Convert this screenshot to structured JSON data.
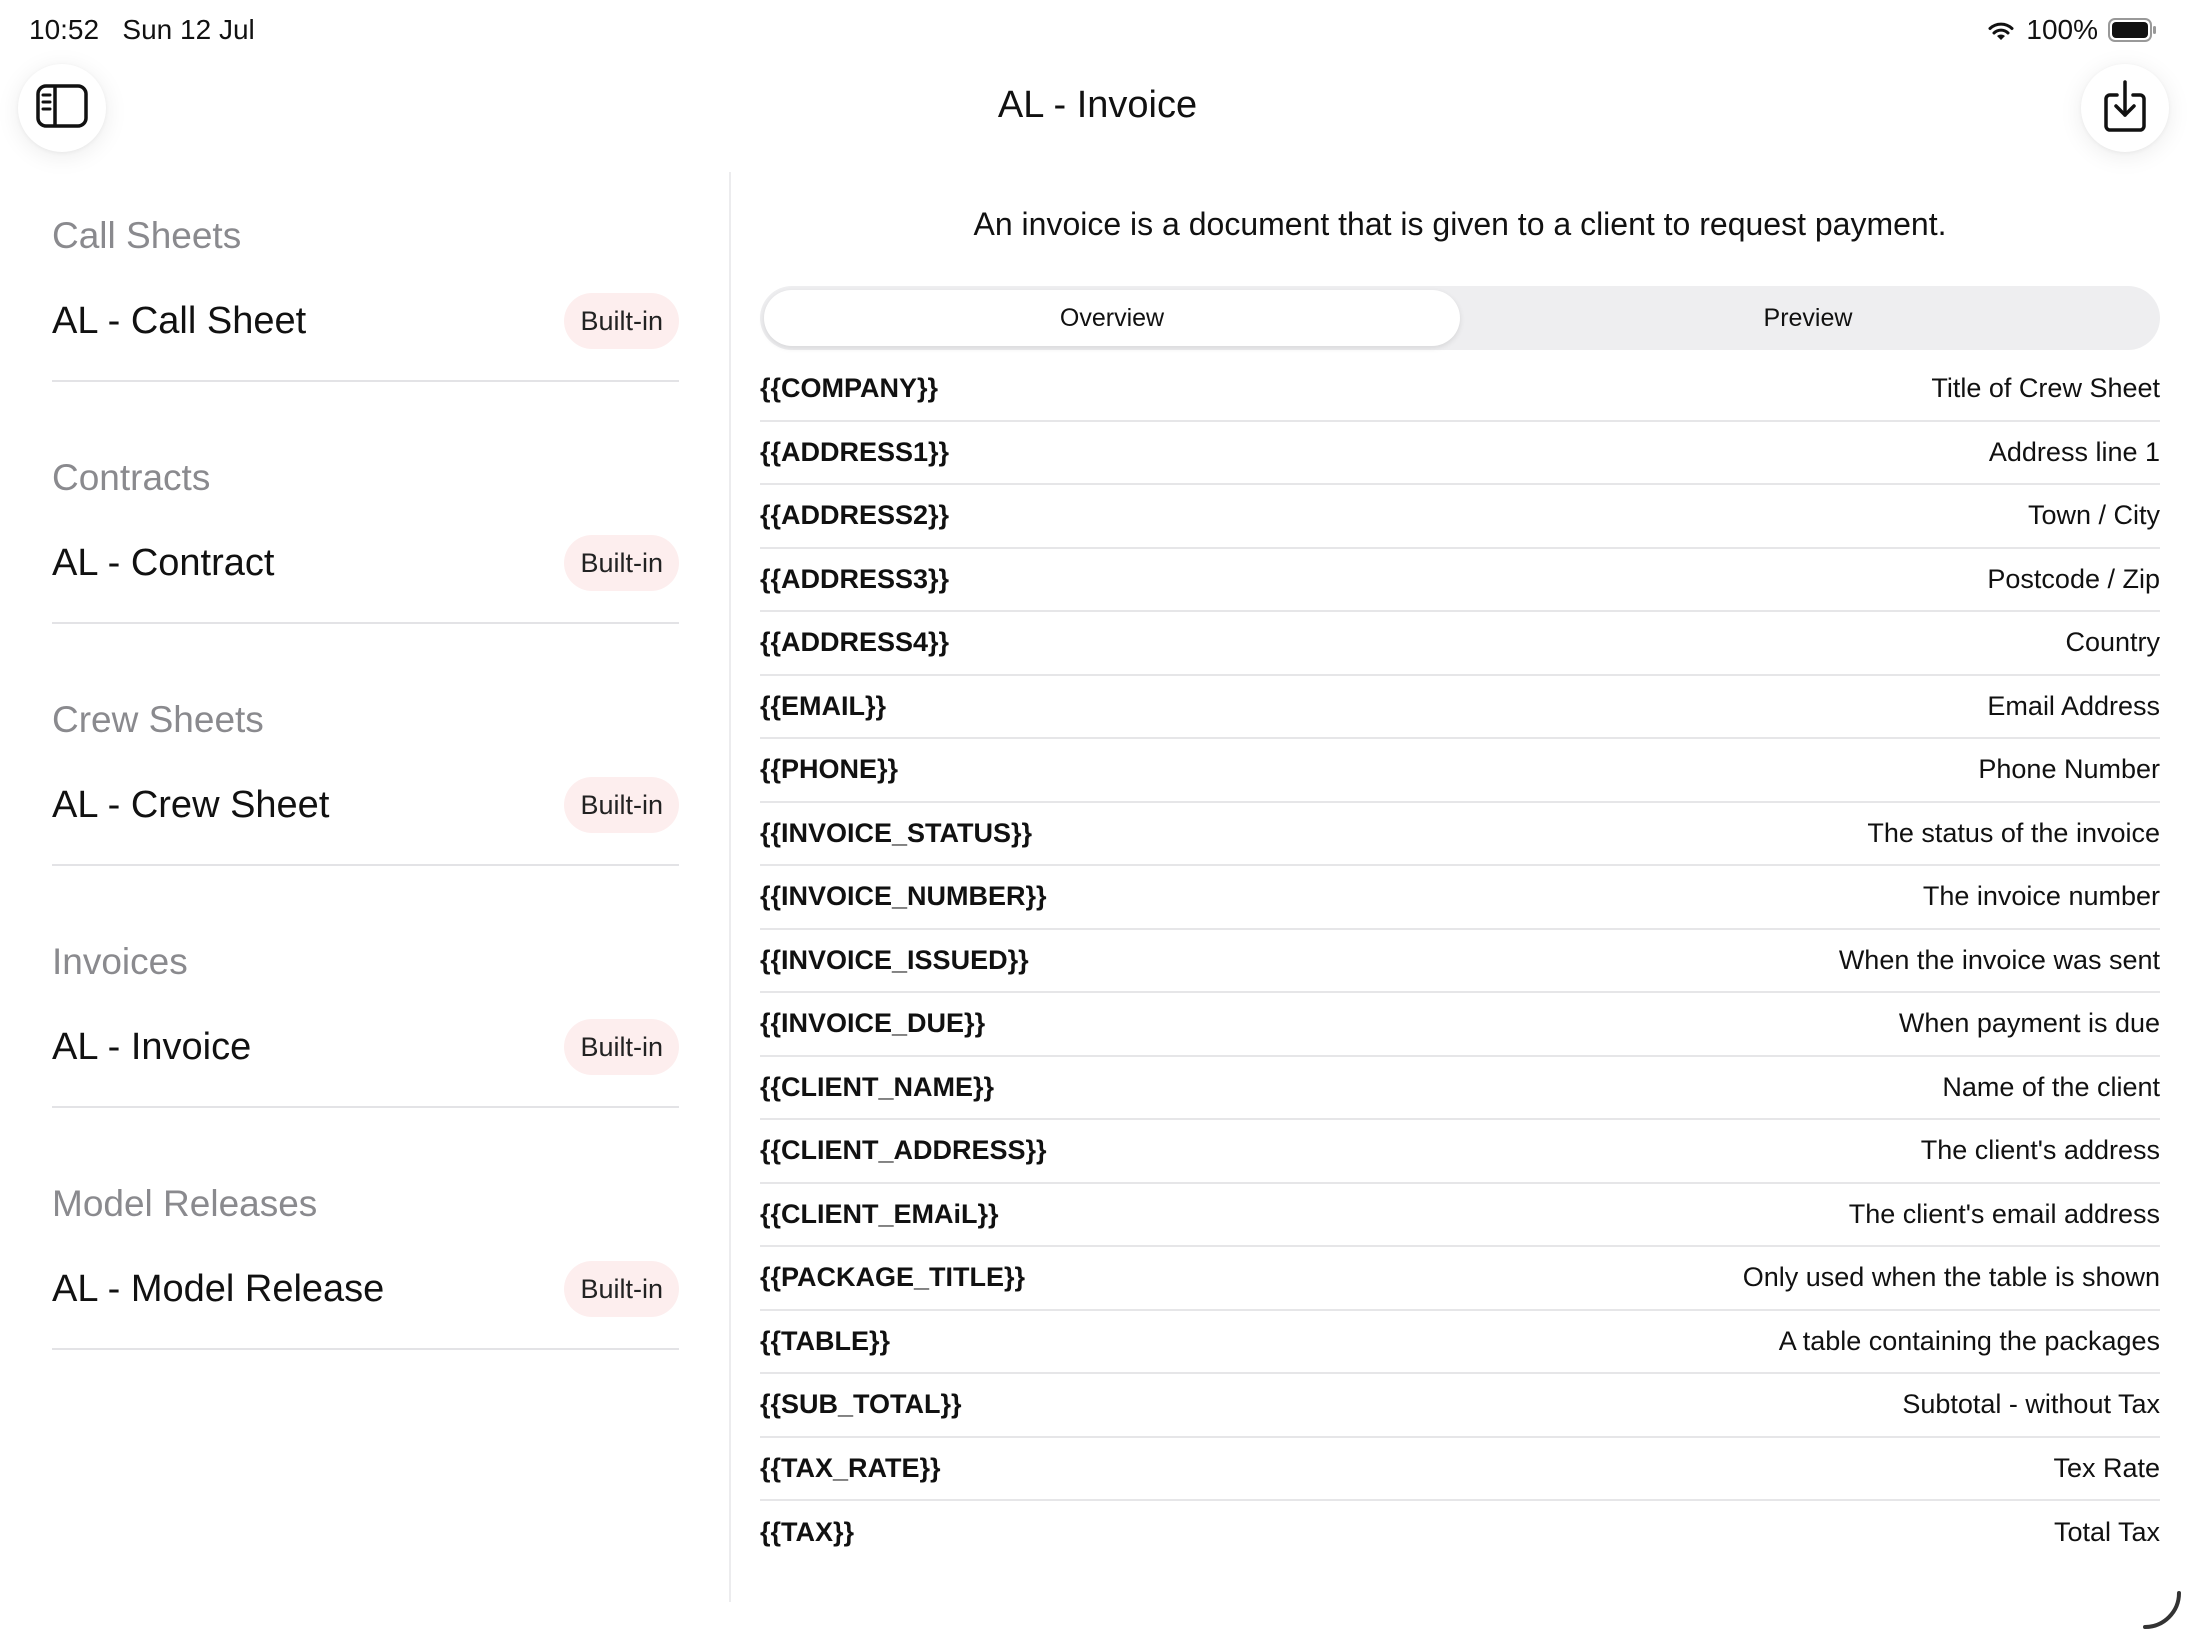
{
  "status_bar": {
    "time": "10:52",
    "date": "Sun 12 Jul",
    "battery": "100%"
  },
  "header": {
    "title": "AL - Invoice",
    "left_icon": "sidebar-icon",
    "right_icon": "export-icon"
  },
  "sidebar": {
    "sections": [
      {
        "header": "Call Sheets",
        "item": "AL - Call Sheet",
        "badge": "Built-in"
      },
      {
        "header": "Contracts",
        "item": "AL - Contract",
        "badge": "Built-in"
      },
      {
        "header": "Crew Sheets",
        "item": "AL - Crew Sheet",
        "badge": "Built-in"
      },
      {
        "header": "Invoices",
        "item": "AL - Invoice",
        "badge": "Built-in"
      },
      {
        "header": "Model Releases",
        "item": "AL - Model Release",
        "badge": "Built-in"
      }
    ]
  },
  "main": {
    "description": "An invoice is a document that is given to a client to request payment.",
    "tabs": [
      {
        "label": "Overview",
        "active": true
      },
      {
        "label": "Preview",
        "active": false
      }
    ],
    "rows": [
      {
        "key": "{{COMPANY}}",
        "desc": "Title of Crew Sheet"
      },
      {
        "key": "{{ADDRESS1}}",
        "desc": "Address line 1"
      },
      {
        "key": "{{ADDRESS2}}",
        "desc": "Town / City"
      },
      {
        "key": "{{ADDRESS3}}",
        "desc": "Postcode / Zip"
      },
      {
        "key": "{{ADDRESS4}}",
        "desc": "Country"
      },
      {
        "key": "{{EMAIL}}",
        "desc": "Email Address"
      },
      {
        "key": "{{PHONE}}",
        "desc": "Phone Number"
      },
      {
        "key": "{{INVOICE_STATUS}}",
        "desc": "The status of the invoice"
      },
      {
        "key": "{{INVOICE_NUMBER}}",
        "desc": "The invoice number"
      },
      {
        "key": "{{INVOICE_ISSUED}}",
        "desc": "When the invoice was sent"
      },
      {
        "key": "{{INVOICE_DUE}}",
        "desc": "When payment is due"
      },
      {
        "key": "{{CLIENT_NAME}}",
        "desc": "Name of the client"
      },
      {
        "key": "{{CLIENT_ADDRESS}}",
        "desc": "The client's address"
      },
      {
        "key": "{{CLIENT_EMAiL}}",
        "desc": "The client's email address"
      },
      {
        "key": "{{PACKAGE_TITLE}}",
        "desc": "Only used when the table is shown"
      },
      {
        "key": "{{TABLE}}",
        "desc": "A table containing the packages"
      },
      {
        "key": "{{SUB_TOTAL}}",
        "desc": "Subtotal - without Tax"
      },
      {
        "key": "{{TAX_RATE}}",
        "desc": "Tex Rate"
      },
      {
        "key": "{{TAX}}",
        "desc": "Total Tax"
      }
    ]
  },
  "colors": {
    "badge_bg": "#fdeeee",
    "section_header": "#8a8a8e",
    "divider": "#e6e6e8"
  }
}
